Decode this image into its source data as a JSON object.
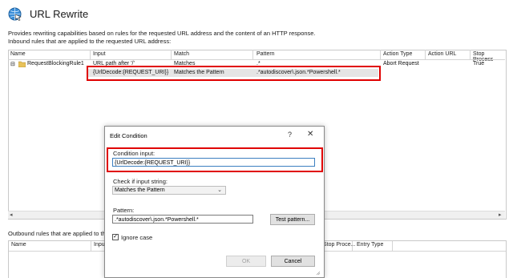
{
  "header": {
    "title": "URL Rewrite",
    "description": "Provides rewriting capabilities based on rules for the requested URL address and the content of an HTTP response.",
    "inbound_label": "Inbound rules that are applied to the requested URL address:"
  },
  "inbound_table": {
    "columns": [
      "Name",
      "Input",
      "Match",
      "Pattern",
      "Action Type",
      "Action URL",
      "Stop Process"
    ],
    "rule": {
      "expander": "⊟",
      "name": "RequestBlockingRule1",
      "input": "URL path after '/'",
      "match": "Matches",
      "pattern": ".*",
      "action_type": "Abort Request",
      "action_url": "",
      "stop_processing": "True"
    },
    "condition": {
      "input": "{UrlDecode:{REQUEST_URI}}",
      "match": "Matches the Pattern",
      "pattern": ".*autodiscover\\.json.*Powershell.*"
    }
  },
  "outbound": {
    "label": "Outbound rules that are applied to the h",
    "columns": [
      "Name",
      "Input",
      "Stop Proce...",
      "Entry Type"
    ]
  },
  "dialog": {
    "title": "Edit Condition",
    "help": "?",
    "close": "✕",
    "condition_input_label": "Condition input:",
    "condition_input_value": "{UrlDecode:{REQUEST_URI}}",
    "check_label": "Check if input string:",
    "check_value": "Matches the Pattern",
    "pattern_label": "Pattern:",
    "pattern_value": ".*autodiscover\\.json.*Powershell.*",
    "test_button": "Test pattern...",
    "ignore_case_label": "Ignore case",
    "ignore_case_checked": "✓",
    "ok_button": "OK",
    "cancel_button": "Cancel"
  },
  "colors": {
    "highlight": "#e00000",
    "selection": "#e5e5e5"
  }
}
